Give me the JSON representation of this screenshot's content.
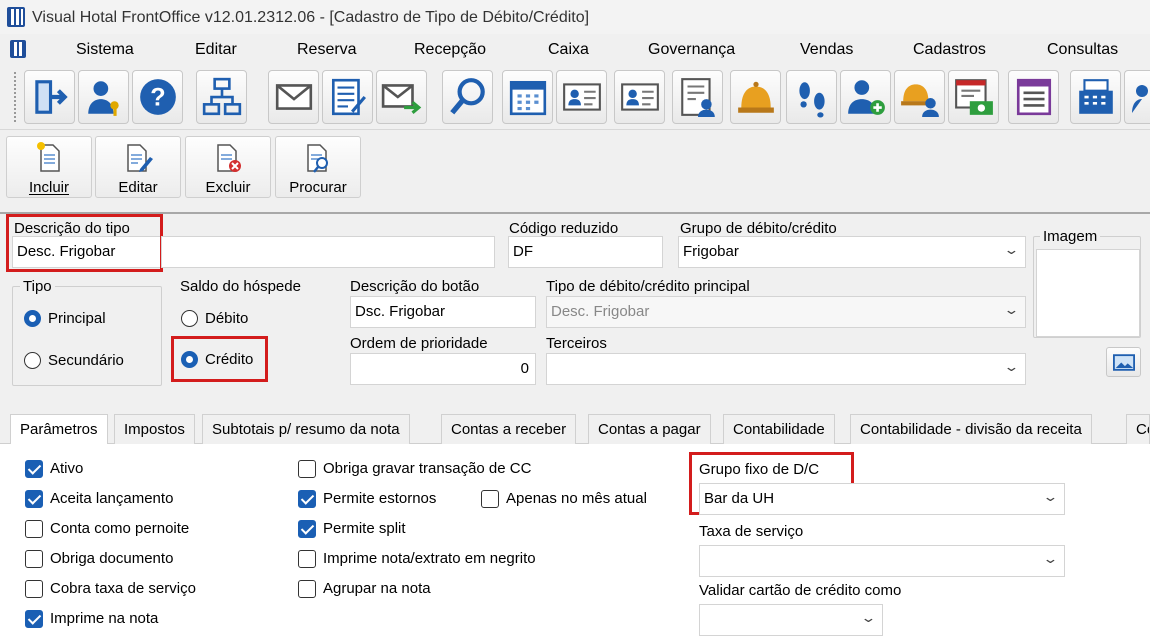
{
  "window": {
    "title": "Visual Hotal FrontOffice v12.01.2312.06 - [Cadastro de Tipo de Débito/Crédito]"
  },
  "menu": [
    "Sistema",
    "Editar",
    "Reserva",
    "Recepção",
    "Caixa",
    "Governança",
    "Vendas",
    "Cadastros",
    "Consultas"
  ],
  "toolbar_icons": [
    "exit-icon",
    "user-key-icon",
    "help-icon",
    "flowchart-icon",
    "mail-icon",
    "checklist-icon",
    "send-mail-icon",
    "search-icon",
    "calendar-icon",
    "guest-card-icon",
    "guest-card-alt-icon",
    "report-users-icon",
    "bell-icon",
    "footsteps-icon",
    "add-user-icon",
    "bell-users-icon",
    "cash-report-icon",
    "list-icon",
    "cash-register-icon",
    "more-icon"
  ],
  "actions": {
    "incluir": "Incluir",
    "editar": "Editar",
    "excluir": "Excluir",
    "procurar": "Procurar"
  },
  "form": {
    "descricao_label": "Descrição do tipo",
    "descricao_value": "Desc. Frigobar",
    "codigo_label": "Código reduzido",
    "codigo_value": "DF",
    "grupo_label": "Grupo de débito/crédito",
    "grupo_value": "Frigobar",
    "imagem_label": "Imagem",
    "tipo_label": "Tipo",
    "tipo_principal": "Principal",
    "tipo_secundario": "Secundário",
    "saldo_label": "Saldo do hóspede",
    "saldo_debito": "Débito",
    "saldo_credito": "Crédito",
    "botao_label": "Descrição do botão",
    "botao_value": "Dsc. Frigobar",
    "tipo_principal_label": "Tipo de débito/crédito principal",
    "tipo_principal_value": "Desc. Frigobar",
    "prioridade_label": "Ordem de prioridade",
    "prioridade_value": "0",
    "terceiros_label": "Terceiros",
    "terceiros_value": ""
  },
  "tabs": [
    "Parâmetros",
    "Impostos",
    "Subtotais p/ resumo da nota",
    "Contas a receber",
    "Contas a pagar",
    "Contabilidade",
    "Contabilidade - divisão da receita",
    "Co"
  ],
  "params": {
    "ativo": "Ativo",
    "aceita_lancamento": "Aceita lançamento",
    "conta_pernoite": "Conta como pernoite",
    "obriga_documento": "Obriga documento",
    "cobra_taxa": "Cobra taxa de serviço",
    "imprime_nota": "Imprime na nota",
    "obriga_gravar": "Obriga gravar transação de CC",
    "permite_estornos": "Permite estornos",
    "apenas_mes": "Apenas no mês atual",
    "permite_split": "Permite split",
    "imprime_negrito": "Imprime nota/extrato em negrito",
    "agrupar_nota": "Agrupar na nota",
    "grupo_fixo_label": "Grupo fixo de D/C",
    "grupo_fixo_value": "Bar da UH",
    "taxa_servico_label": "Taxa de serviço",
    "taxa_servico_value": "",
    "validar_cartao_label": "Validar cartão de crédito como",
    "validar_cartao_value": ""
  },
  "colors": {
    "accent": "#1a5fb4",
    "highlight": "#d31c1c"
  }
}
